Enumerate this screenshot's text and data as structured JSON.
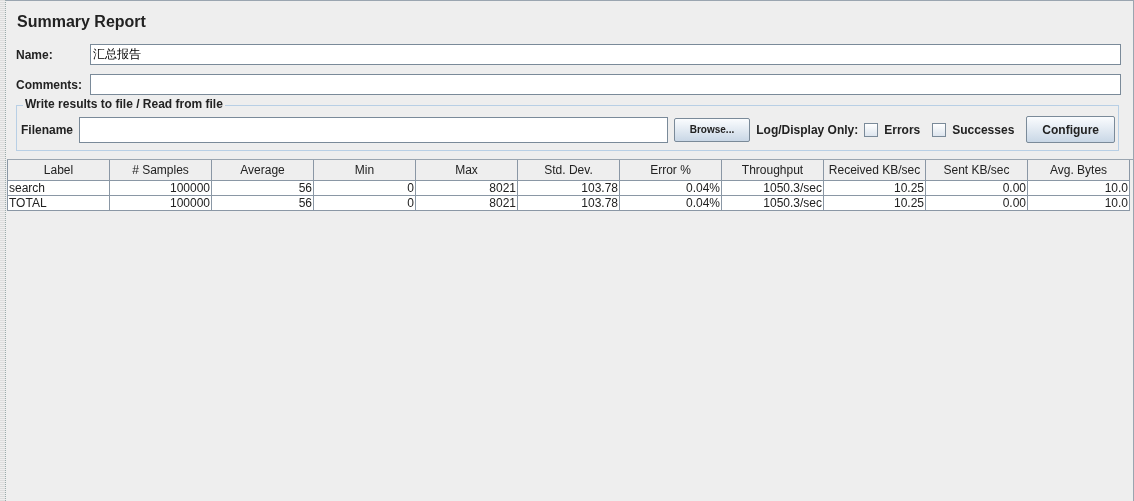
{
  "title": "Summary Report",
  "name_field": {
    "label": "Name:",
    "value": "汇总报告"
  },
  "comments_field": {
    "label": "Comments:"
  },
  "file_group": {
    "legend": "Write results to file / Read from file",
    "filename_label": "Filename",
    "browse_button": "Browse...",
    "log_label": "Log/Display Only:",
    "checkboxes": [
      {
        "label": "Errors",
        "checked": false
      },
      {
        "label": "Successes",
        "checked": false
      }
    ],
    "configure_button": "Configure"
  },
  "table": {
    "columns": [
      "Label",
      "# Samples",
      "Average",
      "Min",
      "Max",
      "Std. Dev.",
      "Error %",
      "Throughput",
      "Received KB/sec",
      "Sent KB/sec",
      "Avg. Bytes"
    ],
    "rows": [
      [
        "search",
        "100000",
        "56",
        "0",
        "8021",
        "103.78",
        "0.04%",
        "1050.3/sec",
        "10.25",
        "0.00",
        "10.0"
      ],
      [
        "TOTAL",
        "100000",
        "56",
        "0",
        "8021",
        "103.78",
        "0.04%",
        "1050.3/sec",
        "10.25",
        "0.00",
        "10.0"
      ]
    ]
  }
}
